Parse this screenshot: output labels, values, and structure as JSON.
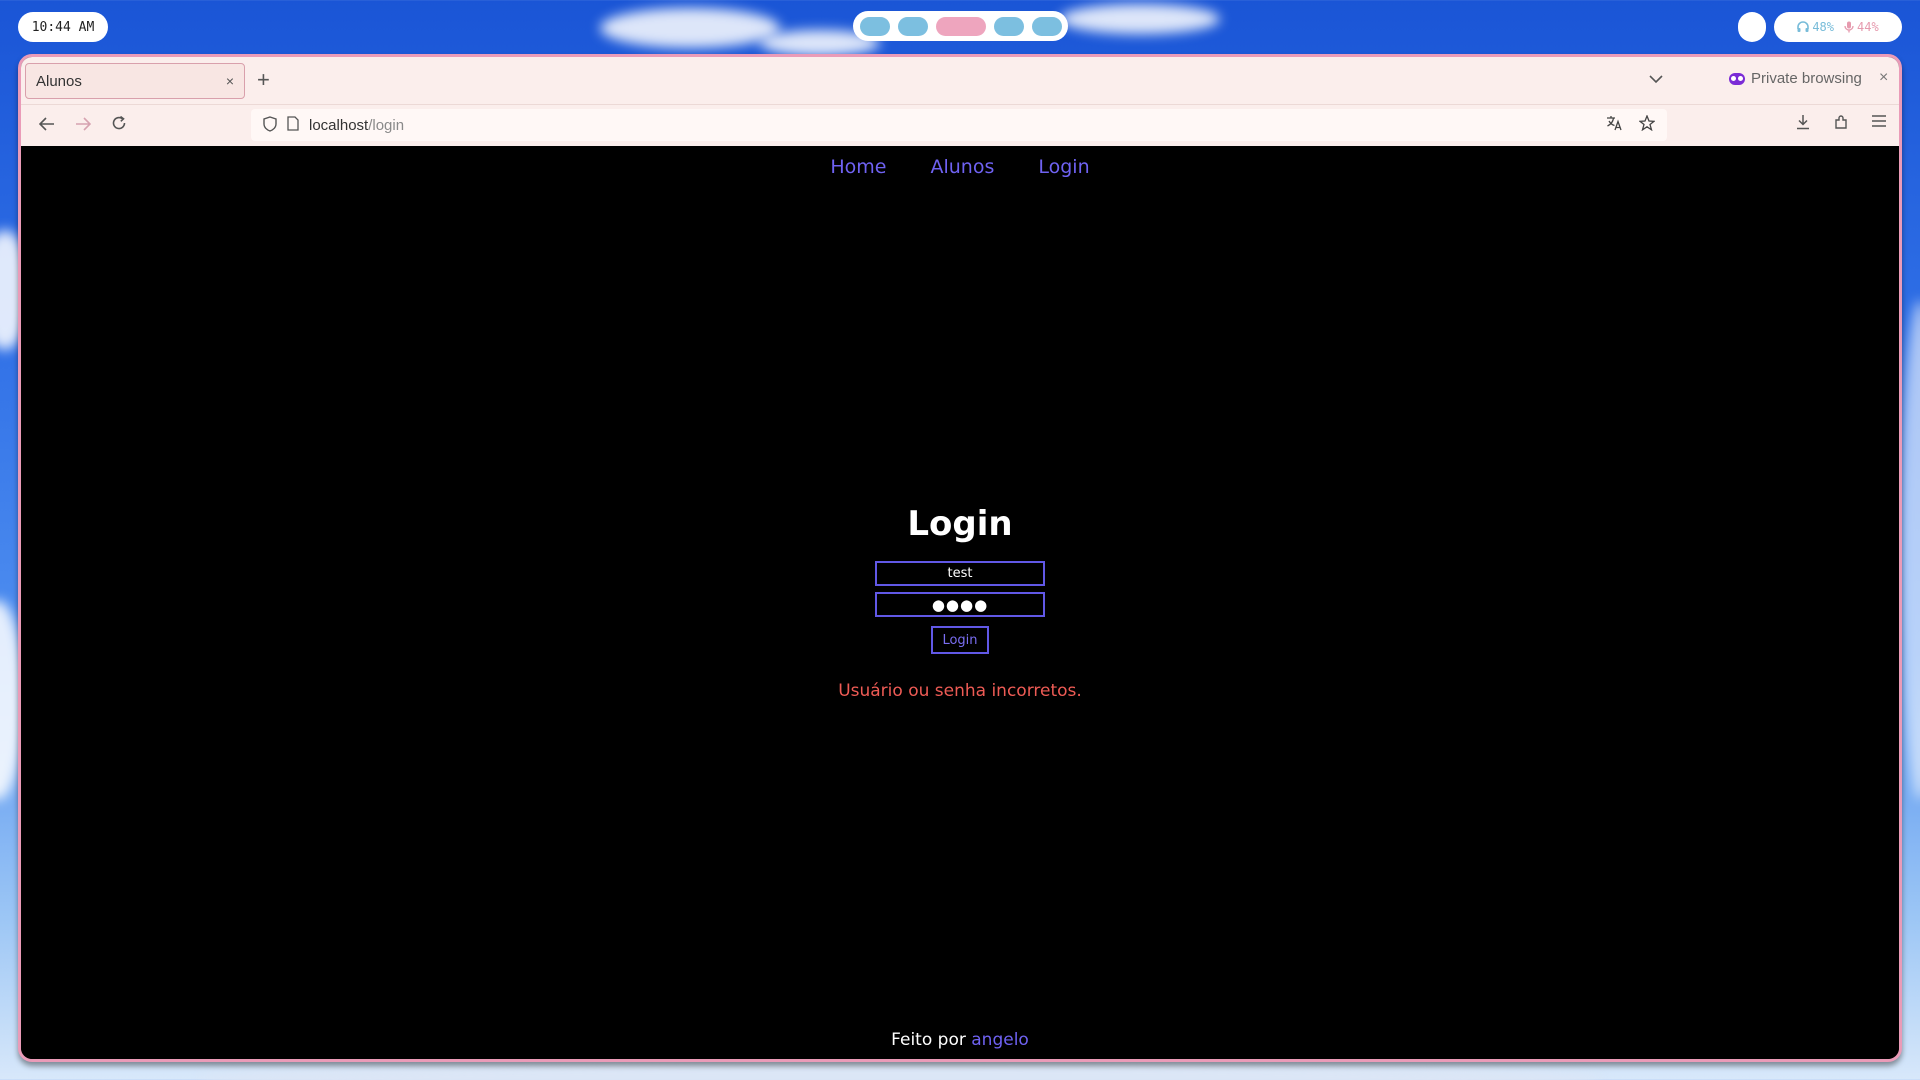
{
  "system_bar": {
    "clock": "10:44 AM",
    "headphones_level": "48%",
    "mic_level": "44%"
  },
  "browser": {
    "tab": {
      "title": "Alunos",
      "close": "×"
    },
    "new_tab": "+",
    "private_label": "Private browsing",
    "window_close": "×",
    "url_host": "localhost",
    "url_path": "/login"
  },
  "page": {
    "nav": {
      "home": "Home",
      "alunos": "Alunos",
      "login": "Login"
    },
    "title": "Login",
    "username_value": "test",
    "password_value": "●●●●",
    "submit_label": "Login",
    "error_message": "Usuário ou senha incorretos.",
    "footer_prefix": "Feito por ",
    "footer_author": "angelo"
  },
  "colors": {
    "accent": "#6f62f2",
    "error": "#ee5b55",
    "window_border": "#ea9bb8"
  }
}
